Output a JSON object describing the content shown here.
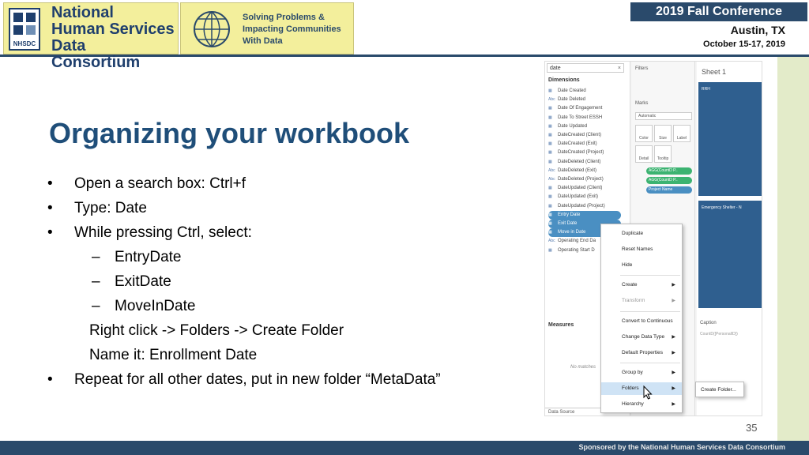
{
  "header": {
    "logo_lines": [
      "National",
      "Human Services",
      "Data Consortium"
    ],
    "logo_badge": "NHSDC",
    "tagline_lines": [
      "Solving Problems &",
      "Impacting Communities",
      "With Data"
    ],
    "conference": "2019 Fall Conference",
    "city": "Austin, TX",
    "dates": "October 15-17, 2019"
  },
  "slide": {
    "title": "Organizing your workbook",
    "bullet_char": "•",
    "dash_char": "–",
    "lines": {
      "b1": "Open a search box: Ctrl+f",
      "b2": "Type: Date",
      "b3": "While pressing Ctrl, select:",
      "s1": "EntryDate",
      "s2": "ExitDate",
      "s3": "MoveInDate",
      "p1": "Right click -> Folders -> Create Folder",
      "p2": "Name it: Enrollment Date",
      "b4": "Repeat for all other dates, put in new folder “MetaData”"
    },
    "page_number": "35"
  },
  "footer": {
    "text": "Sponsored by the National Human Services Data Consortium"
  },
  "tableau": {
    "search_value": "date",
    "search_clear": "×",
    "dimensions_label": "Dimensions",
    "dimensions": [
      {
        "icon": "cal",
        "label": "Date Created"
      },
      {
        "icon": "abc",
        "label": "Date Deleted"
      },
      {
        "icon": "cal",
        "label": "Date Of Engagement"
      },
      {
        "icon": "cal",
        "label": "Date To Street ESSH"
      },
      {
        "icon": "cal",
        "label": "Date Updated"
      },
      {
        "icon": "cal",
        "label": "DateCreated (Client)"
      },
      {
        "icon": "cal",
        "label": "DateCreated (Exit)"
      },
      {
        "icon": "cal",
        "label": "DateCreated (Project)"
      },
      {
        "icon": "cal",
        "label": "DateDeleted (Client)"
      },
      {
        "icon": "abc",
        "label": "DateDeleted (Exit)"
      },
      {
        "icon": "abc",
        "label": "DateDeleted (Project)"
      },
      {
        "icon": "cal",
        "label": "DateUpdated (Client)"
      },
      {
        "icon": "cal",
        "label": "DateUpdated (Exit)"
      },
      {
        "icon": "cal",
        "label": "DateUpdated (Project)"
      },
      {
        "icon": "cal",
        "label": "Entry Date",
        "selected": true
      },
      {
        "icon": "cal",
        "label": "Exit Date",
        "selected": true
      },
      {
        "icon": "cal",
        "label": "Move in Date",
        "selected": true
      },
      {
        "icon": "abc",
        "label": "Operating End Da"
      },
      {
        "icon": "cal",
        "label": "Operating Start D"
      }
    ],
    "measures_label": "Measures",
    "no_matches": "No matches",
    "data_source_tab": "Data Source",
    "filters_label": "Filters",
    "marks_label": "Marks",
    "marks_type": "Automatic",
    "mark_buttons": [
      "Color",
      "Size",
      "Label",
      "Detail",
      "Tooltip"
    ],
    "mark_pills": [
      "AGG(CountD P..",
      "AGG(CountD P..",
      "Project Name"
    ],
    "sheet_title": "Sheet 1",
    "bar_label_top": "RRH",
    "bar_label_bottom": "Emergency Shelter - N",
    "caption_label": "Caption",
    "caption_text": "CountD([PersonalID])",
    "context_menu": [
      {
        "label": "Duplicate"
      },
      {
        "label": "Reset Names"
      },
      {
        "label": "Hide"
      },
      {
        "label": "Create",
        "arrow": true
      },
      {
        "label": "Transform",
        "arrow": true,
        "disabled": true
      },
      {
        "label": "Convert to Continuous"
      },
      {
        "label": "Change Data Type",
        "arrow": true
      },
      {
        "label": "Default Properties",
        "arrow": true
      },
      {
        "label": "Group by",
        "arrow": true
      },
      {
        "label": "Folders",
        "arrow": true,
        "highlight": true
      },
      {
        "label": "Hierarchy",
        "arrow": true
      }
    ],
    "submenu_item": "Create Folder...",
    "arrow_char": "▶"
  }
}
